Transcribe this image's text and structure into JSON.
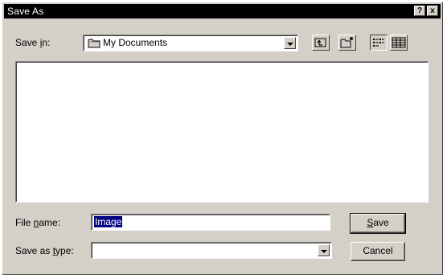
{
  "window": {
    "title": "Save As",
    "help_label": "?",
    "close_label": "x"
  },
  "save_in": {
    "label_pre": "Save ",
    "label_accel": "i",
    "label_post": "n:",
    "value": "My Documents"
  },
  "toolbar": {
    "icons": [
      "up-one-level-icon",
      "create-new-folder-icon",
      "list-view-icon",
      "details-view-icon"
    ]
  },
  "file_name": {
    "label_pre": "File ",
    "label_accel": "n",
    "label_post": "ame:",
    "value": "Image"
  },
  "save_as_type": {
    "label_pre": "Save as ",
    "label_accel": "t",
    "label_post": "ype:",
    "value": ""
  },
  "buttons": {
    "save_accel": "S",
    "save_rest": "ave",
    "cancel_label": "Cancel"
  },
  "colors": {
    "dialog_face": "#d4d0c8",
    "title_bar": "#000000",
    "selection": "#000080"
  }
}
